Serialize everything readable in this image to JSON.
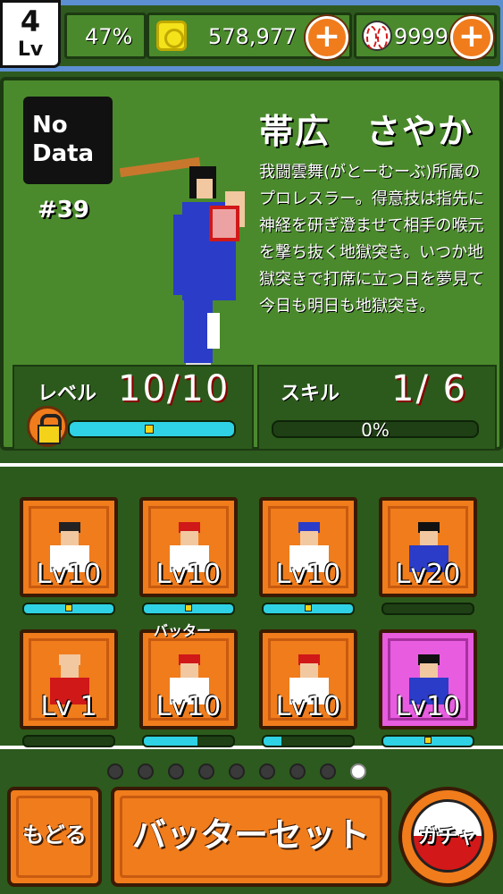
{
  "header": {
    "level": "4",
    "level_label": "Lv",
    "progress": "47%",
    "coins": "578,977",
    "balls": "9999",
    "plus_symbol": "+"
  },
  "profile": {
    "nodata_line1": "No",
    "nodata_line2": "Data",
    "number": "#39",
    "name": "帯広　さやか",
    "description": "我闘雲舞(がとーむーぶ)所属のプロレスラー。得意技は指先に神経を研ぎ澄ませて相手の喉元を撃ち抜く地獄突き。いつか地獄突きで打席に立つ日を夢見て今日も明日も地獄突き。",
    "level_label": "レベル",
    "level_value": "10/10",
    "level_bar_fraction": 1.0,
    "skill_label": "スキル",
    "skill_value": "1/ 6",
    "skill_percent": "0%",
    "skill_bar_fraction": 0.0
  },
  "cards": [
    {
      "level": "Lv10",
      "bar": 1.0,
      "locked": true,
      "tag": ""
    },
    {
      "level": "Lv10",
      "bar": 1.0,
      "locked": true,
      "tag": ""
    },
    {
      "level": "Lv10",
      "bar": 1.0,
      "locked": true,
      "tag": ""
    },
    {
      "level": "Lv20",
      "bar": 0.0,
      "locked": false,
      "tag": ""
    },
    {
      "level": "Lv 1",
      "bar": 0.0,
      "locked": false,
      "tag": ""
    },
    {
      "level": "Lv10",
      "bar": 0.6,
      "locked": false,
      "tag": "バッター"
    },
    {
      "level": "Lv10",
      "bar": 0.2,
      "locked": false,
      "tag": ""
    },
    {
      "level": "Lv10",
      "bar": 1.0,
      "locked": true,
      "tag": ""
    }
  ],
  "pager": {
    "count": 9,
    "active": 8
  },
  "buttons": {
    "back": "もどる",
    "batter_set": "バッターセット",
    "gacha": "ガチャ"
  },
  "colors": {
    "accent_orange": "#f07c1c",
    "panel_green": "#4a8a2c",
    "bar_cyan": "#2fd2e4"
  }
}
